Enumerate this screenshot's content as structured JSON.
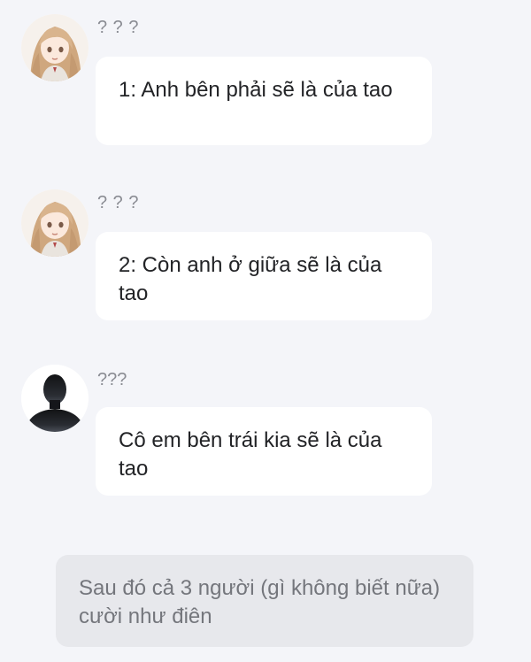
{
  "messages": [
    {
      "sender": "? ? ?",
      "avatar": "anime-girl-avatar-icon",
      "text": "1: Anh bên phải sẽ là của tao"
    },
    {
      "sender": "? ? ?",
      "avatar": "anime-girl-avatar-icon",
      "text": "2: Còn anh ở giữa sẽ là của tao"
    },
    {
      "sender": "???",
      "avatar": "silhouette-avatar-icon",
      "text": "Cô em bên trái kia sẽ là của tao"
    }
  ],
  "narration": "Sau đó cả 3 người (gì không biết nữa) cười như điên",
  "colors": {
    "background": "#f4f5f9",
    "bubble": "#ffffff",
    "narration_bubble": "#e7e8ec",
    "sender_text": "#8a8c93"
  }
}
